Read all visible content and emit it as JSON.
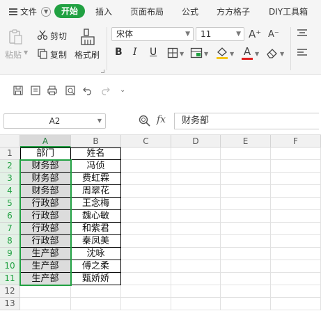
{
  "menu": {
    "file_label": "文件",
    "tabs": [
      {
        "label": "开始",
        "active": true
      },
      {
        "label": "插入"
      },
      {
        "label": "页面布局"
      },
      {
        "label": "公式"
      },
      {
        "label": "方方格子"
      },
      {
        "label": "DIY工具箱"
      }
    ]
  },
  "ribbon": {
    "paste_label": "粘贴",
    "cut_label": "剪切",
    "copy_label": "复制",
    "format_painter_label": "格式刷",
    "font_name": "宋体",
    "font_size": "11",
    "bold_label": "B",
    "italic_label": "I",
    "underline_label": "U",
    "font_color_label": "A",
    "grow_font_label": "A⁺",
    "shrink_font_label": "A⁻",
    "accent_color": "#21a142",
    "font_color": "#e02020",
    "fill_color": "#f5c518"
  },
  "formula_bar": {
    "cell_ref": "A2",
    "fx_label": "fx",
    "content": "财务部"
  },
  "sheet": {
    "columns": [
      "A",
      "B",
      "C",
      "D",
      "E",
      "F"
    ],
    "rows": [
      "1",
      "2",
      "3",
      "4",
      "5",
      "6",
      "7",
      "8",
      "9",
      "10",
      "11",
      "12",
      "13"
    ],
    "header": [
      "部门",
      "姓名"
    ],
    "data": [
      [
        "财务部",
        "冯侦"
      ],
      [
        "财务部",
        "费虹霖"
      ],
      [
        "财务部",
        "周翠花"
      ],
      [
        "行政部",
        "王念梅"
      ],
      [
        "行政部",
        "魏心敏"
      ],
      [
        "行政部",
        "和紫君"
      ],
      [
        "行政部",
        "秦凤美"
      ],
      [
        "生产部",
        "沈咏"
      ],
      [
        "生产部",
        "傅之柔"
      ],
      [
        "生产部",
        "甄娇娇"
      ]
    ]
  }
}
